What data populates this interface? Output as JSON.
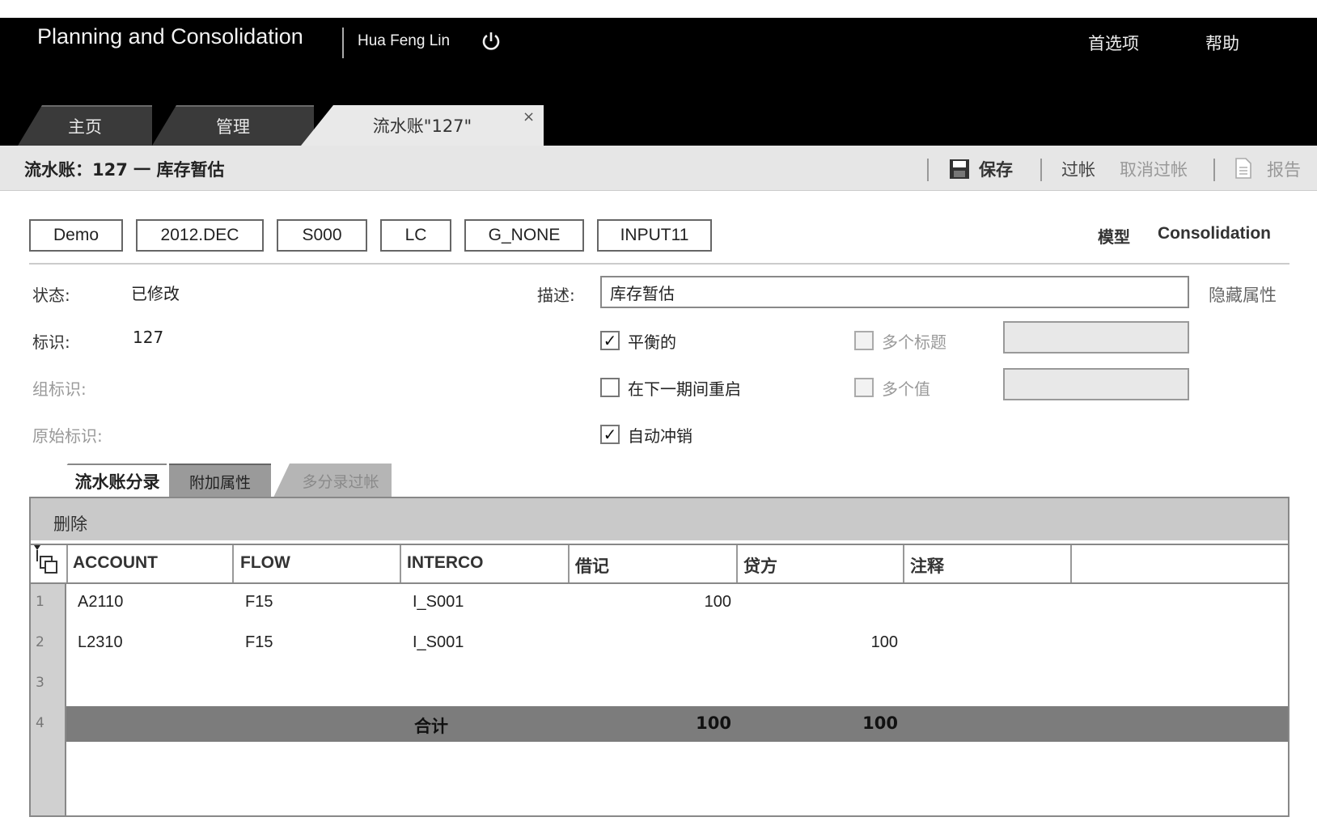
{
  "header": {
    "app_title": "Planning and Consolidation",
    "user": "Hua Feng Lin",
    "preferences": "首选项",
    "help": "帮助"
  },
  "tabs": [
    {
      "label": "主页"
    },
    {
      "label": "管理"
    },
    {
      "label": "流水账\"127\""
    }
  ],
  "toolbar": {
    "title": "流水账：127 一 库存暂估",
    "save": "保存",
    "post": "过帐",
    "unpost": "取消过帐",
    "report": "报告"
  },
  "dimensions": [
    "Demo",
    "2012.DEC",
    "S000",
    "LC",
    "G_NONE",
    "INPUT11"
  ],
  "model": {
    "label": "模型",
    "value": "Consolidation"
  },
  "props": {
    "status_label": "状态:",
    "status_value": "已修改",
    "id_label": "标识:",
    "id_value": "127",
    "group_id_label": "组标识:",
    "orig_id_label": "原始标识:",
    "desc_label": "描述:",
    "desc_value": "库存暂估",
    "hide_attr": "隐藏属性"
  },
  "checkboxes": {
    "balanced": {
      "label": "平衡的",
      "checked": true
    },
    "reopen": {
      "label": "在下一期间重启",
      "checked": false
    },
    "auto_reverse": {
      "label": "自动冲销",
      "checked": true
    },
    "multi_header": {
      "label": "多个标题",
      "checked": false
    },
    "multi_value": {
      "label": "多个值",
      "checked": false
    }
  },
  "subtabs": [
    "流水账分录",
    "附加属性",
    "多分录过帐"
  ],
  "grid": {
    "delete_label": "删除",
    "columns": [
      "ACCOUNT",
      "FLOW",
      "INTERCO",
      "借记",
      "贷方",
      "注释"
    ],
    "rows": [
      {
        "num": "1",
        "account": "A2110",
        "flow": "F15",
        "interco": "I_S001",
        "debit": "100",
        "credit": ""
      },
      {
        "num": "2",
        "account": "L2310",
        "flow": "F15",
        "interco": "I_S001",
        "debit": "",
        "credit": "100"
      },
      {
        "num": "3",
        "account": "",
        "flow": "",
        "interco": "",
        "debit": "",
        "credit": ""
      }
    ],
    "total": {
      "num": "4",
      "label": "合计",
      "debit": "100",
      "credit": "100"
    }
  }
}
